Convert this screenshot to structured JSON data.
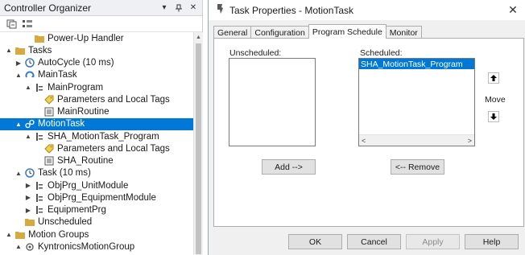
{
  "organizer": {
    "title": "Controller Organizer",
    "pin_glyph": "▾",
    "unpin_glyph": "📌",
    "close_glyph": "✕",
    "tree": [
      {
        "label": "Power-Up Handler",
        "indent": 2,
        "icon": "folder-icon",
        "expander": ""
      },
      {
        "label": "Tasks",
        "indent": 0,
        "icon": "folder-icon",
        "expander": "▲"
      },
      {
        "label": "AutoCycle (10 ms)",
        "indent": 1,
        "icon": "clock-icon",
        "expander": "▶"
      },
      {
        "label": "MainTask",
        "indent": 1,
        "icon": "continuous-task-icon",
        "expander": "▲"
      },
      {
        "label": "MainProgram",
        "indent": 2,
        "icon": "program-icon",
        "expander": "▲"
      },
      {
        "label": "Parameters and Local Tags",
        "indent": 3,
        "icon": "tag-icon",
        "expander": ""
      },
      {
        "label": "MainRoutine",
        "indent": 3,
        "icon": "routine-icon",
        "expander": ""
      },
      {
        "label": "MotionTask",
        "indent": 1,
        "icon": "motion-task-icon",
        "expander": "▲",
        "selected": true
      },
      {
        "label": "SHA_MotionTask_Program",
        "indent": 2,
        "icon": "program-icon",
        "expander": "▲"
      },
      {
        "label": "Parameters and Local Tags",
        "indent": 3,
        "icon": "tag-icon",
        "expander": ""
      },
      {
        "label": "SHA_Routine",
        "indent": 3,
        "icon": "routine-icon",
        "expander": ""
      },
      {
        "label": "Task (10 ms)",
        "indent": 1,
        "icon": "clock-icon",
        "expander": "▲"
      },
      {
        "label": "ObjPrg_UnitModule",
        "indent": 2,
        "icon": "program-icon",
        "expander": "▶"
      },
      {
        "label": "ObjPrg_EquipmentModule",
        "indent": 2,
        "icon": "program-icon",
        "expander": "▶"
      },
      {
        "label": "EquipmentPrg",
        "indent": 2,
        "icon": "program-icon",
        "expander": "▶"
      },
      {
        "label": "Unscheduled",
        "indent": 1,
        "icon": "folder-icon",
        "expander": ""
      },
      {
        "label": "Motion Groups",
        "indent": 0,
        "icon": "folder-icon",
        "expander": "▲"
      },
      {
        "label": "KyntronicsMotionGroup",
        "indent": 1,
        "icon": "motion-group-icon",
        "expander": "▲"
      }
    ]
  },
  "dialog": {
    "title": "Task Properties - MotionTask",
    "close_glyph": "✕",
    "tabs": [
      "General",
      "Configuration",
      "Program Schedule",
      "Monitor"
    ],
    "active_tab": 2,
    "unscheduled_label": "Unscheduled:",
    "scheduled_label": "Scheduled:",
    "scheduled_items": [
      "SHA_MotionTask_Program"
    ],
    "move_label": "Move",
    "move_up_glyph": "🠉",
    "move_down_glyph": "🠋",
    "add_button": "Add -->",
    "remove_button": "<-- Remove",
    "scroll_left": "<",
    "scroll_right": ">",
    "ok_button": "OK",
    "cancel_button": "Cancel",
    "apply_button": "Apply",
    "help_button": "Help"
  },
  "colors": {
    "selection": "#0078d7",
    "panel": "#f0f0f0"
  }
}
